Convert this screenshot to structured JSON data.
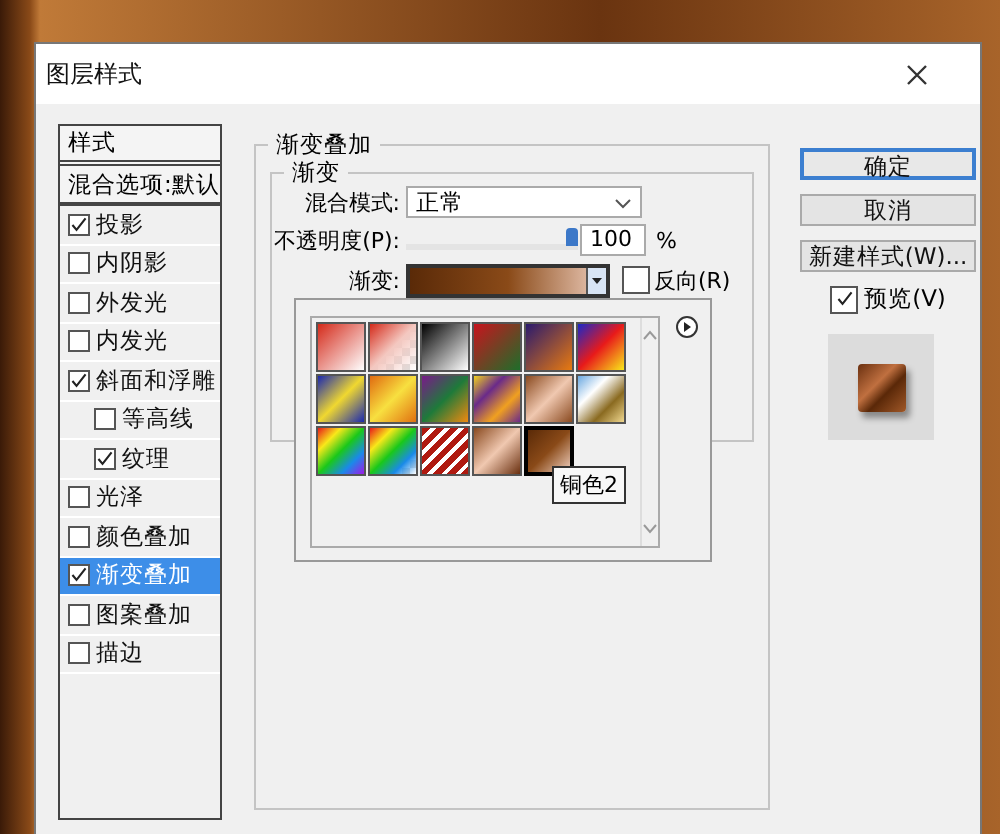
{
  "window": {
    "title": "图层样式"
  },
  "styles_list": {
    "header": "样式",
    "blending_options": "混合选项:默认",
    "items": [
      {
        "label": "投影",
        "checked": true,
        "selected": false
      },
      {
        "label": "内阴影",
        "checked": false,
        "selected": false
      },
      {
        "label": "外发光",
        "checked": false,
        "selected": false
      },
      {
        "label": "内发光",
        "checked": false,
        "selected": false
      },
      {
        "label": "斜面和浮雕",
        "checked": true,
        "selected": false,
        "children": [
          {
            "label": "等高线",
            "checked": false,
            "selected": false
          },
          {
            "label": "纹理",
            "checked": true,
            "selected": false
          }
        ]
      },
      {
        "label": "光泽",
        "checked": false,
        "selected": false
      },
      {
        "label": "颜色叠加",
        "checked": false,
        "selected": false
      },
      {
        "label": "渐变叠加",
        "checked": true,
        "selected": true
      },
      {
        "label": "图案叠加",
        "checked": false,
        "selected": false
      },
      {
        "label": "描边",
        "checked": false,
        "selected": false
      }
    ]
  },
  "gradient_overlay": {
    "title": "渐变叠加",
    "group_title": "渐变",
    "blend_mode": {
      "label": "混合模式:",
      "value": "正常"
    },
    "opacity": {
      "label": "不透明度(P):",
      "level": 1,
      "value": "100",
      "unit": "%"
    },
    "gradient": {
      "label": "渐变:"
    },
    "reverse": {
      "label": "反向(R)",
      "checked": false
    },
    "presets": {
      "tooltip": "铜色2",
      "swatches": [
        {
          "selected": false
        },
        {
          "selected": false
        },
        {
          "selected": false
        },
        {
          "selected": false
        },
        {
          "selected": false
        },
        {
          "selected": false
        },
        {
          "selected": false
        },
        {
          "selected": false
        },
        {
          "selected": false
        },
        {
          "selected": false
        },
        {
          "selected": false
        },
        {
          "selected": false
        },
        {
          "selected": false
        },
        {
          "selected": false
        },
        {
          "selected": false
        },
        {
          "selected": false
        },
        {
          "selected": true
        }
      ]
    }
  },
  "buttons": [
    {
      "label": "确定",
      "default": true
    },
    {
      "label": "取消",
      "default": false
    },
    {
      "label": "新建样式(W)...",
      "default": false
    }
  ],
  "preview": {
    "label": "预览(V)",
    "checked": true
  }
}
